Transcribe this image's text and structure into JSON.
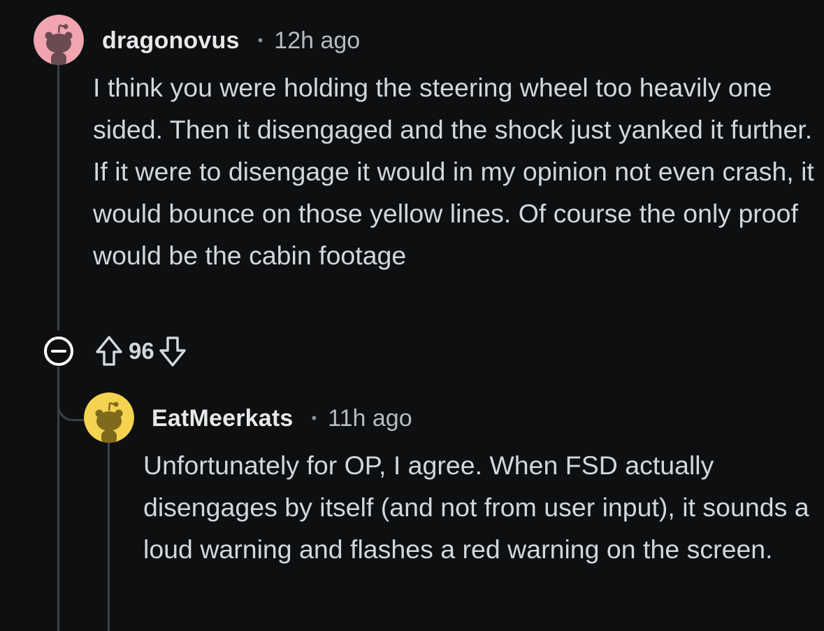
{
  "thread": {
    "comments": [
      {
        "username": "dragonovus",
        "separator": "•",
        "timestamp": "12h ago",
        "avatar": {
          "icon": "reddit-snoo-icon",
          "color": "#f2a5b0"
        },
        "body": "I think you were holding the steering wheel too heavily one sided. Then it disengaged and the shock just yanked it further. If it were to disengage it would in my opinion not even crash, it would bounce on those yellow lines. Of course the only proof would be the cabin footage",
        "actions": {
          "collapse_icon": "minus-circle-icon",
          "upvote_icon": "arrow-up-icon",
          "vote_count": "96",
          "downvote_icon": "arrow-down-icon"
        }
      },
      {
        "username": "EatMeerkats",
        "separator": "•",
        "timestamp": "11h ago",
        "avatar": {
          "icon": "reddit-snoo-icon",
          "color": "#f3d34f"
        },
        "body": "Unfortunately for OP, I agree. When FSD actually disengages by itself (and not from user input), it sounds a loud warning and flashes a red warning on the screen."
      }
    ]
  },
  "colors": {
    "background": "#0e0f11",
    "thread_line": "#3c3f43",
    "username": "#e6e8ea",
    "body_text": "#d2d7dc",
    "timestamp": "#b7bcc1"
  }
}
